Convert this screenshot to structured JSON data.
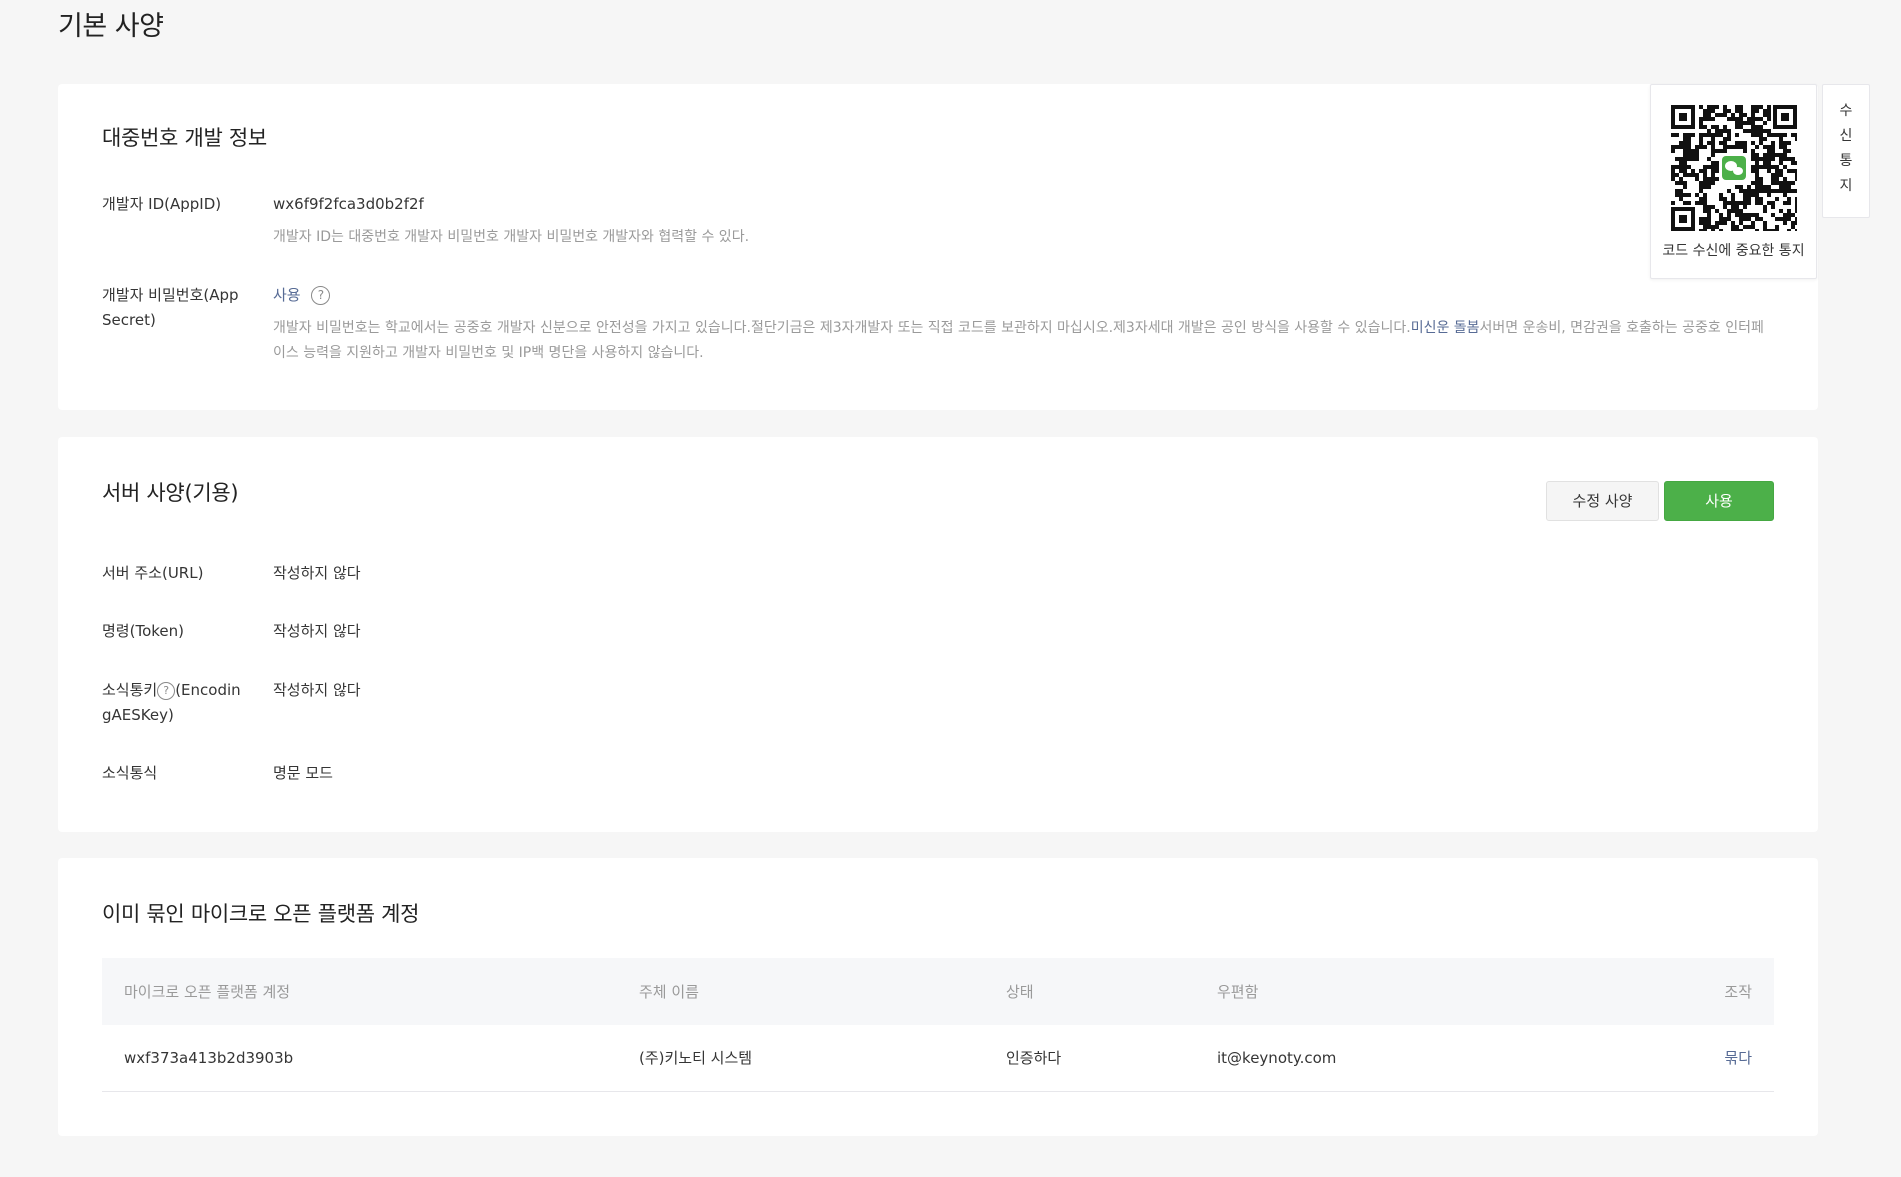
{
  "page": {
    "title": "기본 사양"
  },
  "dev_info": {
    "title": "대중번호 개발 정보",
    "appid_label": "개발자 ID(AppID)",
    "appid_value": "wx6f9f2fca3d0b2f2f",
    "appid_desc": "개발자 ID는 대중번호 개발자 비밀번호 개발자 비밀번호 개발자와 협력할 수 있다.",
    "secret_label": "개발자 비밀번호(App Secret)",
    "secret_action": "사용",
    "help_glyph": "?",
    "secret_desc_part1": "개발자 비밀번호는 학교에서는 공중호 개발자 신분으로 안전성을 가지고 있습니다.절단기금은 제3자개발자 또는 직접 코드를 보관하지 마십시오.제3자세대 개발은 공인 방식을 사용할 수 있습니다.",
    "secret_desc_link": "미신운 돌봄",
    "secret_desc_part2": "서버면 운송비, 면감권을 호출하는 공중호 인터페이스 능력을 지원하고 개발자 비밀번호 및 IP백 명단을 사용하지 않습니다."
  },
  "server_config": {
    "title": "서버 사양(기용)",
    "edit_button": "수정 사양",
    "enable_button": "사용",
    "rows": [
      {
        "label": "서버 주소(URL)",
        "value": "작성하지 않다"
      },
      {
        "label": "명령(Token)",
        "value": "작성하지 않다"
      },
      {
        "label_part1": "소식통키",
        "label_part2": "(EncodingAESKey)",
        "value": "작성하지 않다"
      },
      {
        "label": "소식통식",
        "value": "명문 모드"
      }
    ]
  },
  "bound_accounts": {
    "title": "이미 묶인 마이크로 오픈 플랫폼 계정",
    "columns": [
      "마이크로 오픈 플랫폼 계정",
      "주체 이름",
      "상태",
      "우편함",
      "조작"
    ],
    "rows": [
      {
        "account": "wxf373a413b2d3903b",
        "subject": "(주)키노티 시스템",
        "status": "인증하다",
        "email": "it@keynoty.com",
        "action": "묶다"
      }
    ]
  },
  "qr_popup": {
    "caption": "코드 수신에 중요한 통지",
    "icon": "wechat-icon"
  },
  "side_tab": {
    "chars": [
      "수",
      "신",
      "통",
      "지"
    ]
  },
  "colors": {
    "link": "#576b95",
    "primary": "#4cb049",
    "muted": "#9a9a9a"
  }
}
